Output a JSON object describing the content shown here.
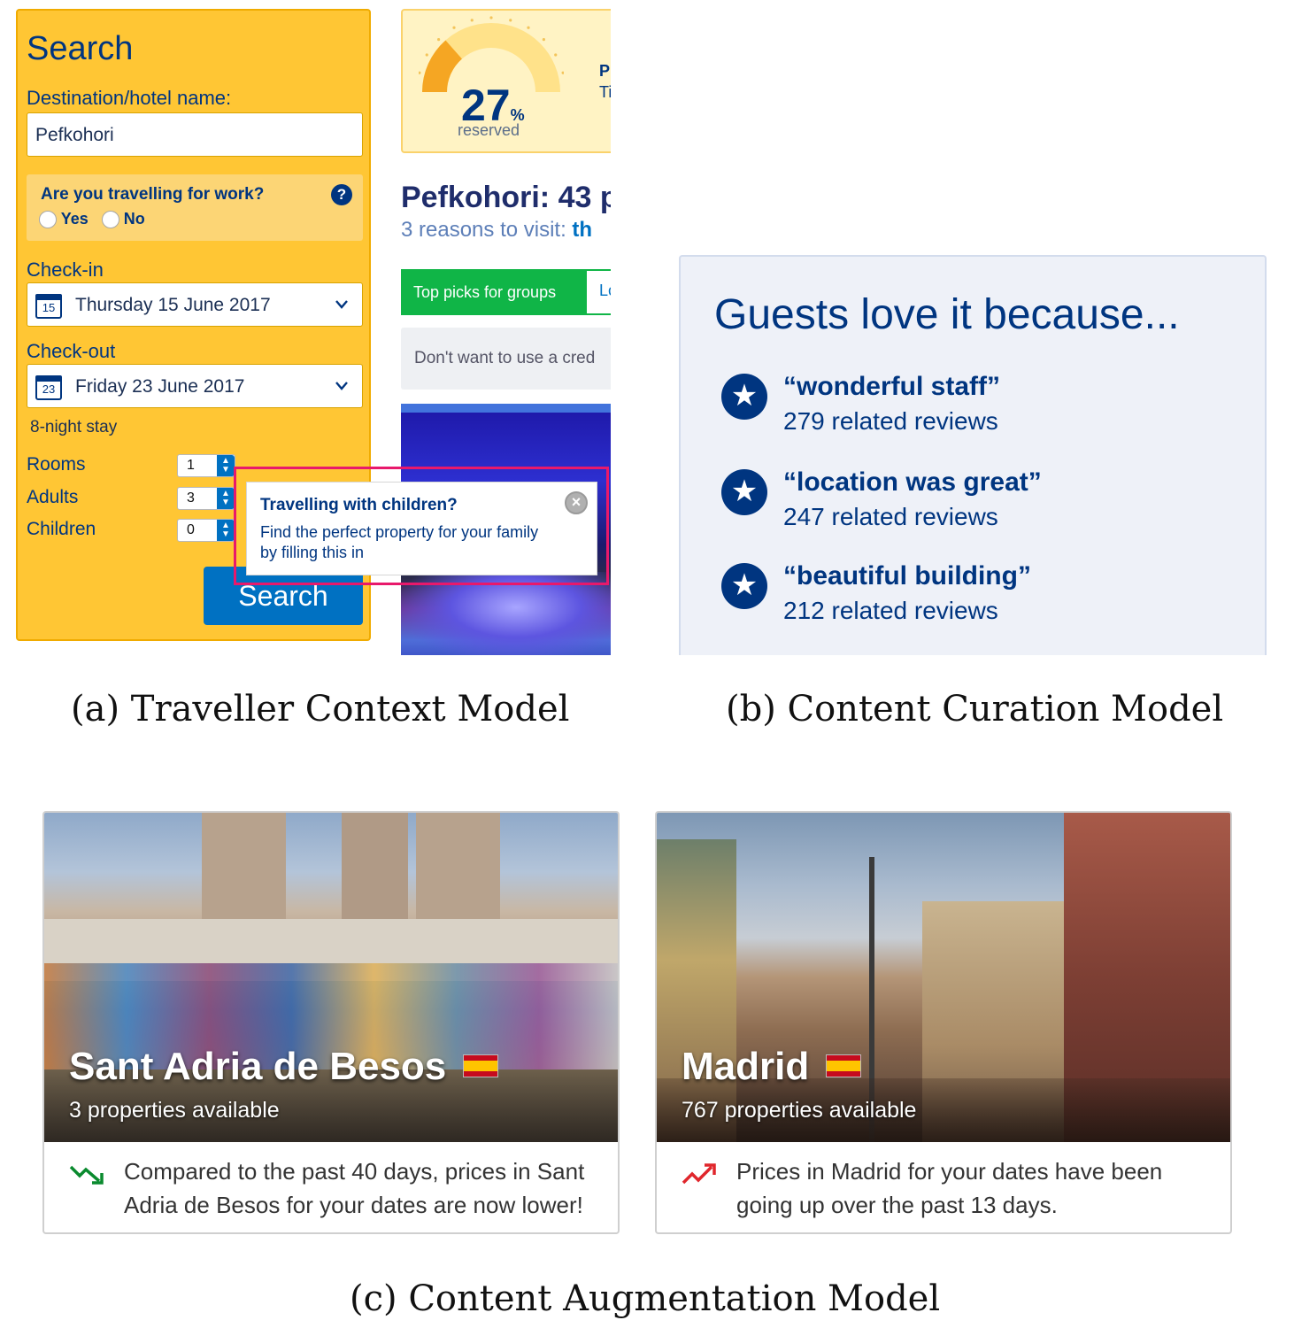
{
  "panel_a": {
    "search": {
      "title": "Search",
      "destination_label": "Destination/hotel name:",
      "destination_value": "Pefkohori",
      "work_question": "Are you travelling for work?",
      "help_icon": "question-circle-icon",
      "yes_label": "Yes",
      "no_label": "No",
      "checkin_label": "Check-in",
      "checkin_day": "15",
      "checkin_value": "Thursday 15 June 2017",
      "checkout_label": "Check-out",
      "checkout_day": "23",
      "checkout_value": "Friday 23 June 2017",
      "stay_length": "8-night stay",
      "rooms_label": "Rooms",
      "rooms_value": "1",
      "adults_label": "Adults",
      "adults_value": "3",
      "children_label": "Children",
      "children_value": "0",
      "search_button": "Search"
    },
    "occupancy": {
      "percent": "27",
      "percent_sign": "%",
      "reserved_label": "reserved",
      "fraction": 0.27,
      "side_text_1": "P",
      "side_text_2": "Ti"
    },
    "headline": "Pefkohori: 43 p",
    "reasons_prefix": "3 reasons to visit: ",
    "reasons_cut": "th",
    "tabs": {
      "active": "Top picks for groups",
      "next": "Lo"
    },
    "credit_notice": "Don't want to use a cred",
    "tooltip": {
      "title": "Travelling with children?",
      "body": "Find the perfect property for your family by filling this in",
      "close_icon": "close-circle-icon"
    },
    "caption": "(a)  Traveller Context Model"
  },
  "panel_b": {
    "heading": "Guests love it because...",
    "items": [
      {
        "quote": "“wonderful staff”",
        "reviews": "279 related reviews"
      },
      {
        "quote": "“location was great”",
        "reviews": "247 related reviews"
      },
      {
        "quote": "“beautiful building”",
        "reviews": "212 related reviews"
      }
    ],
    "star_icon": "star-icon",
    "caption": "(b)  Content Curation Model"
  },
  "panel_c": {
    "cards": [
      {
        "city": "Sant Adria de Besos",
        "properties": "3 properties available",
        "trend_icon": "trend-down-icon",
        "trend_color": "#0a8a2e",
        "text": "Compared to the past 40 days, prices in Sant Adria de Besos for your dates are now lower!"
      },
      {
        "city": "Madrid",
        "properties": "767 properties available",
        "trend_icon": "trend-up-icon",
        "trend_color": "#e0262c",
        "text": "Prices in Madrid for your dates have been going up over the past 13 days."
      }
    ],
    "flag_icon": "spain-flag-icon",
    "caption": "(c)  Content Augmentation Model"
  },
  "colors": {
    "brand_blue": "#003580",
    "search_yellow": "#ffc634",
    "button_blue": "#0071c2",
    "highlight_pink": "#e8196b",
    "tab_green": "#10b547"
  }
}
